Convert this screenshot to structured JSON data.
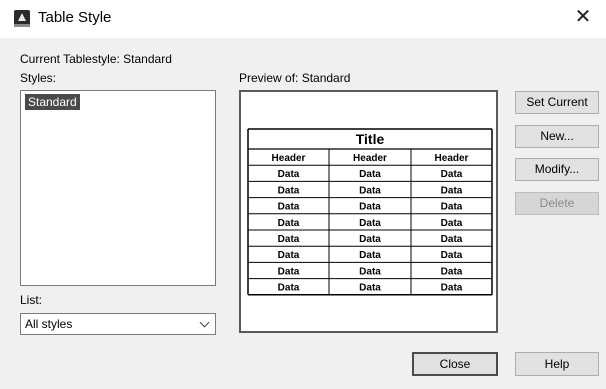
{
  "window": {
    "title": "Table Style",
    "close_symbol": "✕"
  },
  "current_tablestyle_label": "Current Tablestyle: Standard",
  "styles_label": "Styles:",
  "styles_list": [
    "Standard"
  ],
  "list_label": "List:",
  "list_filter_value": "All styles",
  "preview_label": "Preview of: Standard",
  "preview_table": {
    "title": "Title",
    "headers": [
      "Header",
      "Header",
      "Header"
    ],
    "rows": [
      [
        "Data",
        "Data",
        "Data"
      ],
      [
        "Data",
        "Data",
        "Data"
      ],
      [
        "Data",
        "Data",
        "Data"
      ],
      [
        "Data",
        "Data",
        "Data"
      ],
      [
        "Data",
        "Data",
        "Data"
      ],
      [
        "Data",
        "Data",
        "Data"
      ],
      [
        "Data",
        "Data",
        "Data"
      ],
      [
        "Data",
        "Data",
        "Data"
      ]
    ]
  },
  "buttons": {
    "set_current": "Set Current",
    "new": "New...",
    "modify": "Modify...",
    "delete": "Delete",
    "close": "Close",
    "help": "Help"
  },
  "icons": {
    "app": "autocad-app-icon",
    "close": "close-icon",
    "dropdown": "chevron-down-icon"
  }
}
